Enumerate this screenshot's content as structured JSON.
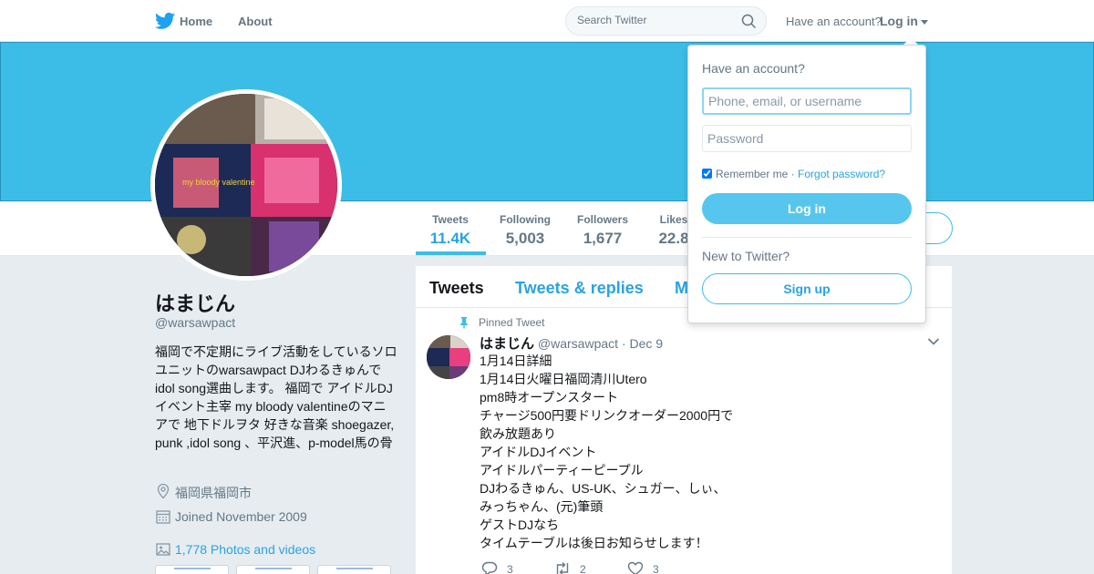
{
  "nav": {
    "home": "Home",
    "about": "About",
    "search_placeholder": "Search Twitter",
    "have_account": "Have an account?",
    "login": "Log in"
  },
  "colors": {
    "accent": "#2aa3e0",
    "banner": "#3cbde8",
    "button": "#56c6ef"
  },
  "stats": [
    {
      "label": "Tweets",
      "value": "11.4K"
    },
    {
      "label": "Following",
      "value": "5,003"
    },
    {
      "label": "Followers",
      "value": "1,677"
    },
    {
      "label": "Likes",
      "value": "22.8"
    }
  ],
  "profile": {
    "name": "はまじん",
    "handle": "@warsawpact",
    "bio": "福岡で不定期にライブ活動をしているソロユニットのwarsawpact DJわるきゅんでidol song選曲します。 福岡で アイドルDJイベント主宰 my bloody valentineのマニアで 地下ドルヲタ 好きな音楽 shoegazer, punk ,idol song 、平沢進、p-model馬の骨",
    "location": "福岡県福岡市",
    "joined": "Joined November 2009",
    "photos": "1,778 Photos and videos"
  },
  "tabs": [
    "Tweets",
    "Tweets & replies",
    "M"
  ],
  "tweet": {
    "pinned_label": "Pinned Tweet",
    "author": "はまじん",
    "handle": "@warsawpact",
    "date": "· Dec 9",
    "lines": [
      "1月14日詳細",
      "1月14日火曜日福岡清川Utero",
      "pm8時オープンスタート",
      "チャージ500円要ドリンクオーダー2000円で",
      "飲み放題あり",
      "アイドルDJイベント",
      "アイドルパーティーピープル",
      "DJわるきゅん、US-UK、シュガー、しぃ、",
      "みっちゃん、(元)筆頭",
      "ゲストDJなち",
      "タイムテーブルは後日お知らせします！"
    ],
    "replies": "3",
    "retweets": "2",
    "likes": "3"
  },
  "login_dropdown": {
    "title": "Have an account?",
    "username_placeholder": "Phone, email, or username",
    "password_placeholder": "Password",
    "remember": "Remember me",
    "forgot": "Forgot password?",
    "login_button": "Log in",
    "new_to_twitter": "New to Twitter?",
    "signup_button": "Sign up"
  }
}
